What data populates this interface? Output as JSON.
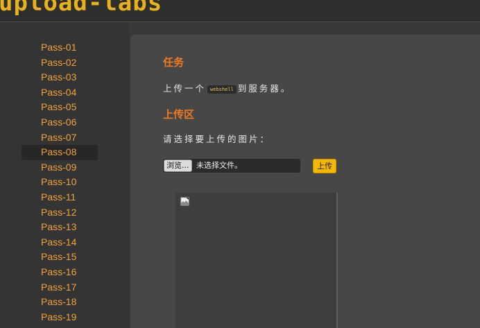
{
  "header": {
    "logo_text": "upload-labs"
  },
  "sidebar": {
    "items": [
      {
        "label": "Pass-01"
      },
      {
        "label": "Pass-02"
      },
      {
        "label": "Pass-03"
      },
      {
        "label": "Pass-04"
      },
      {
        "label": "Pass-05"
      },
      {
        "label": "Pass-06"
      },
      {
        "label": "Pass-07"
      },
      {
        "label": "Pass-08"
      },
      {
        "label": "Pass-09"
      },
      {
        "label": "Pass-10"
      },
      {
        "label": "Pass-11"
      },
      {
        "label": "Pass-12"
      },
      {
        "label": "Pass-13"
      },
      {
        "label": "Pass-14"
      },
      {
        "label": "Pass-15"
      },
      {
        "label": "Pass-16"
      },
      {
        "label": "Pass-17"
      },
      {
        "label": "Pass-18"
      },
      {
        "label": "Pass-19"
      }
    ],
    "active_label": "Pass-08"
  },
  "task": {
    "heading": "任务",
    "text_before": "上传一个",
    "code": "webshell",
    "text_after": "到服务器。"
  },
  "upload": {
    "heading": "上传区",
    "prompt": "请选择要上传的图片：",
    "browse_label": "浏览...",
    "file_status": "未选择文件。",
    "submit_label": "上传"
  },
  "preview": {
    "icon": "broken-image-icon"
  },
  "colors": {
    "accent_orange": "#f07a1f",
    "link_orange": "#f2a33a",
    "logo_gold": "#e8b21c",
    "button_yellow": "#f5b800",
    "main_bg": "#474747",
    "sidebar_bg": "#343434"
  }
}
